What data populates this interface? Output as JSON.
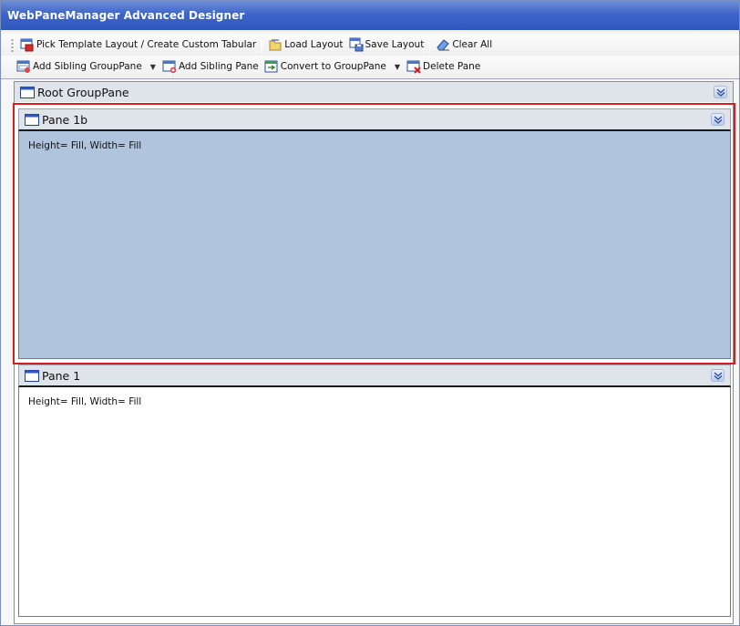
{
  "window": {
    "title": "WebPaneManager Advanced Designer"
  },
  "toolbar1": {
    "pick_template": "Pick Template Layout / Create Custom Tabular",
    "load_layout": "Load Layout",
    "save_layout": "Save Layout",
    "clear_all": "Clear All"
  },
  "toolbar2": {
    "add_sibling_grouppane": "Add Sibling GroupPane",
    "add_sibling_pane": "Add Sibling Pane",
    "convert_to_grouppane": "Convert to GroupPane",
    "delete_pane": "Delete Pane"
  },
  "root": {
    "title": "Root GroupPane"
  },
  "panes": [
    {
      "title": "Pane 1b",
      "info": "Height= Fill, Width= Fill",
      "selected": true,
      "bg": "#b0c4de"
    },
    {
      "title": "Pane 1",
      "info": "Height= Fill, Width= Fill",
      "selected": false,
      "bg": "#ffffff"
    }
  ],
  "colors": {
    "selection_border": "#d91d1d",
    "titlebar": "#3d65c9"
  }
}
